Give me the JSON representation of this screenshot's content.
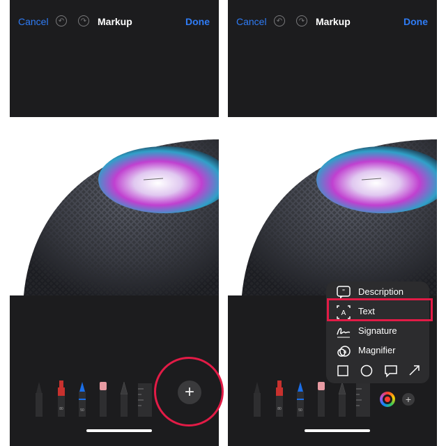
{
  "left_screen": {
    "cancel_label": "Cancel",
    "title": "Markup",
    "done_label": "Done"
  },
  "right_screen": {
    "cancel_label": "Cancel",
    "title": "Markup",
    "done_label": "Done",
    "menu": {
      "items": [
        {
          "label": "Description",
          "icon": "quote-bubble-icon"
        },
        {
          "label": "Text",
          "icon": "text-box-icon"
        },
        {
          "label": "Signature",
          "icon": "signature-icon"
        },
        {
          "label": "Magnifier",
          "icon": "magnifier-icon"
        }
      ],
      "shapes": [
        "square-icon",
        "circle-icon",
        "speech-bubble-icon",
        "arrow-icon"
      ]
    }
  },
  "toolbar_tools": [
    "pen",
    "marker",
    "pencil",
    "eraser",
    "lasso",
    "ruler"
  ],
  "colors": {
    "accent_blue": "#2f7cf6",
    "highlight_red": "#e21b46",
    "bar_background": "#1c1c1e",
    "menu_background": "#2c2c2e"
  }
}
